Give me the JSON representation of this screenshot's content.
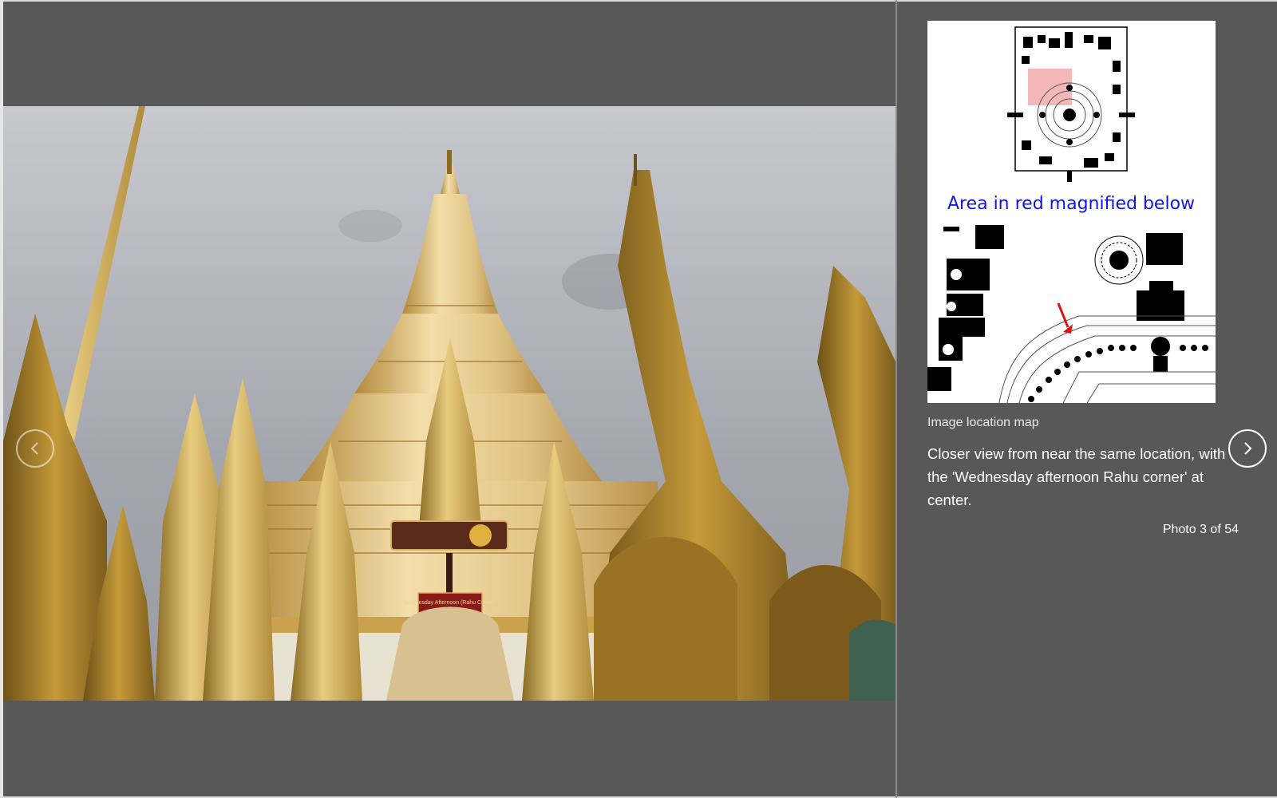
{
  "viewer": {
    "map_label": "Area in red magnified below",
    "map_caption": "Image location map",
    "caption": "Closer view from near the same location, with the 'Wednesday afternoon Rahu corner' at center.",
    "counter": "Photo 3 of 54",
    "prev_icon": "chevron-left-icon",
    "next_icon": "chevron-right-icon"
  },
  "photo": {
    "sign_text": "Wednesday Afternoon (Rahu Corner)"
  },
  "colors": {
    "background": "#585858",
    "map_label": "#1414e0",
    "highlight": "#f4b8b8",
    "arrow": "#e01010",
    "gold": "#c9a03a"
  }
}
